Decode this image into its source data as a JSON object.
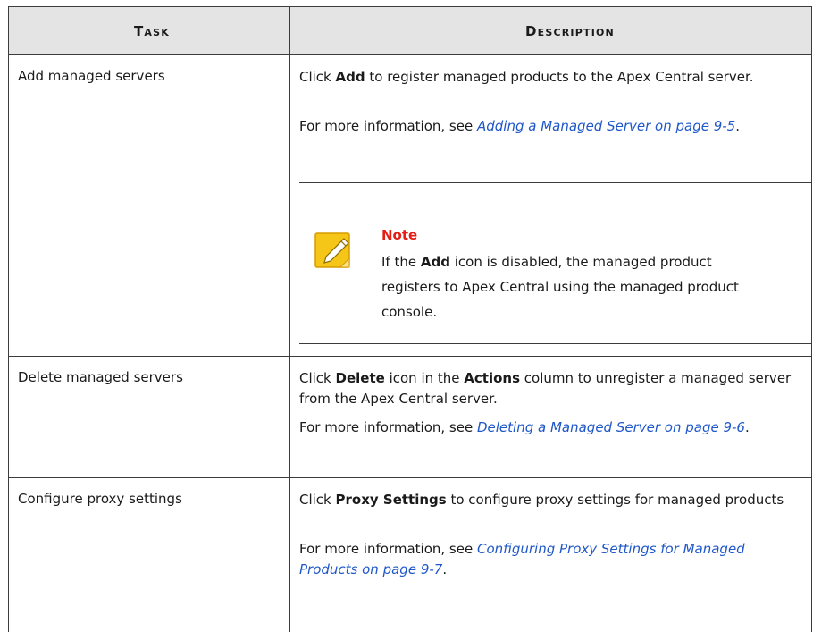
{
  "header": {
    "task": "Task",
    "description": "Description"
  },
  "rows": [
    {
      "task": "Add managed servers",
      "p1_pre": "Click ",
      "p1_bold": "Add",
      "p1_post": " to register managed products to the Apex Central server.",
      "p2_pre": "For more information, see ",
      "p2_link": "Adding a Managed Server on page 9-5",
      "p2_post": "."
    },
    {
      "task": "Delete managed servers",
      "p1_pre": "Click ",
      "p1_bold": "Delete",
      "p1_mid": " icon in the ",
      "p1_bold2": "Actions",
      "p1_post": " column to unregister a managed server from the Apex Central server.",
      "p2_pre": "For more information, see ",
      "p2_link": "Deleting a Managed Server on page 9-6",
      "p2_post": "."
    },
    {
      "task": "Configure proxy settings",
      "p1_pre": "Click ",
      "p1_bold": "Proxy Settings",
      "p1_post": " to configure proxy settings for managed products",
      "p2_pre": "For more information, see ",
      "p2_link": "Configuring Proxy Settings for Managed Products on page 9-7",
      "p2_post": "."
    }
  ],
  "note": {
    "title": "Note",
    "text_pre": "If the ",
    "text_bold": "Add",
    "text_post": " icon is disabled, the managed product registers to Apex Central using the managed product console.",
    "icon": "note-pencil-icon"
  },
  "colors": {
    "header_bg": "#e4e4e4",
    "link": "#1f57c9",
    "note_title": "#e41d15",
    "note_icon": "#f5c518"
  }
}
